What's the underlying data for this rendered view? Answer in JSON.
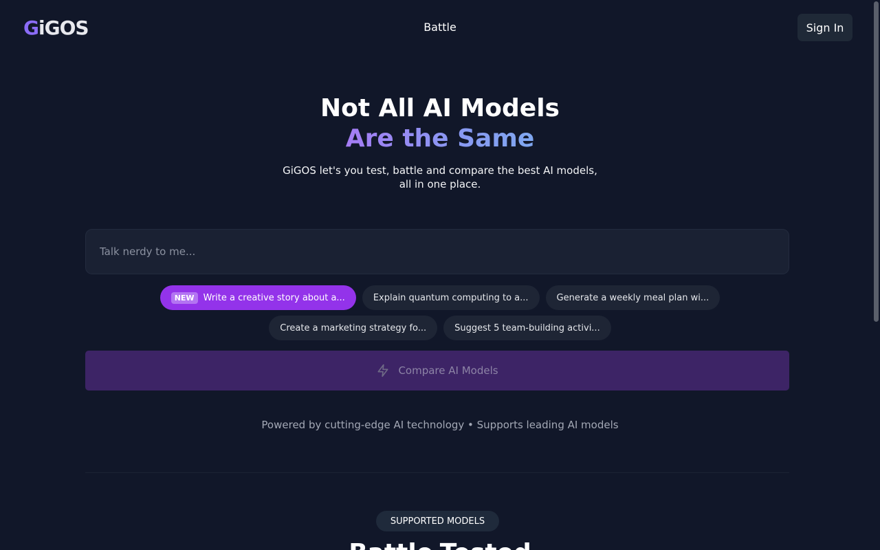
{
  "header": {
    "logo_first": "G",
    "logo_rest": "iGOS",
    "nav_battle": "Battle",
    "signin_label": "Sign In"
  },
  "hero": {
    "title_line1": "Not All AI Models",
    "title_line2": "Are the Same",
    "subtitle_line1": "GiGOS let's you test, battle and compare the best AI models,",
    "subtitle_line2": "all in one place."
  },
  "prompt": {
    "placeholder": "Talk nerdy to me..."
  },
  "suggestions": {
    "new_badge": "NEW",
    "row1": [
      "Write a creative story about a...",
      "Explain quantum computing to a...",
      "Generate a weekly meal plan wi..."
    ],
    "row2": [
      "Create a marketing strategy fo...",
      "Suggest 5 team-building activi..."
    ]
  },
  "compare": {
    "label": "Compare AI Models",
    "icon": "lightning-icon"
  },
  "powered_text": "Powered by cutting-edge AI technology • Supports leading AI models",
  "models_section": {
    "badge": "SUPPORTED MODELS",
    "title": "Battle-Tested"
  },
  "colors": {
    "background": "#111729",
    "accent": "#9333ea",
    "compare_bg": "#3d2466"
  }
}
